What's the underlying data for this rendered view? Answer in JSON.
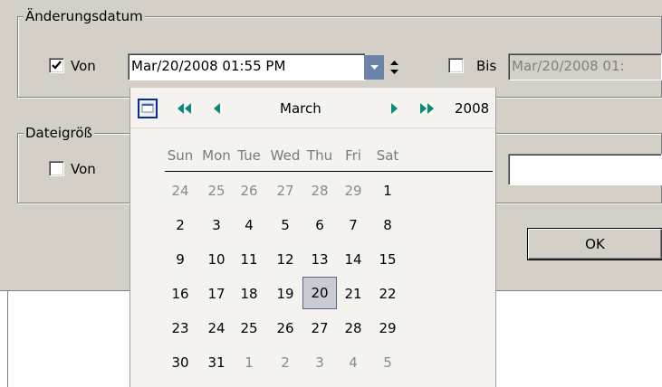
{
  "group_changed": {
    "legend": "Änderungsdatum",
    "from": {
      "label": "Von",
      "checked": true,
      "value": "Mar/20/2008 01:55 PM"
    },
    "to": {
      "label": "Bis",
      "checked": false,
      "value": "Mar/20/2008 01:"
    }
  },
  "group_size": {
    "legend": "Dateigröß",
    "from": {
      "label": "Von",
      "checked": false
    }
  },
  "ok_button": {
    "label": "OK"
  },
  "calendar": {
    "month": "March",
    "year": "2008",
    "weekdays": [
      "Sun",
      "Mon",
      "Tue",
      "Wed",
      "Thu",
      "Fri",
      "Sat"
    ],
    "weeks": [
      [
        {
          "d": "24",
          "o": true
        },
        {
          "d": "25",
          "o": true
        },
        {
          "d": "26",
          "o": true
        },
        {
          "d": "27",
          "o": true
        },
        {
          "d": "28",
          "o": true
        },
        {
          "d": "29",
          "o": true
        },
        {
          "d": "1",
          "o": false
        }
      ],
      [
        {
          "d": "2",
          "o": false
        },
        {
          "d": "3",
          "o": false
        },
        {
          "d": "4",
          "o": false
        },
        {
          "d": "5",
          "o": false
        },
        {
          "d": "6",
          "o": false
        },
        {
          "d": "7",
          "o": false
        },
        {
          "d": "8",
          "o": false
        }
      ],
      [
        {
          "d": "9",
          "o": false
        },
        {
          "d": "10",
          "o": false
        },
        {
          "d": "11",
          "o": false
        },
        {
          "d": "12",
          "o": false
        },
        {
          "d": "13",
          "o": false
        },
        {
          "d": "14",
          "o": false
        },
        {
          "d": "15",
          "o": false
        }
      ],
      [
        {
          "d": "16",
          "o": false
        },
        {
          "d": "17",
          "o": false
        },
        {
          "d": "18",
          "o": false
        },
        {
          "d": "19",
          "o": false
        },
        {
          "d": "20",
          "o": false,
          "selected": true
        },
        {
          "d": "21",
          "o": false
        },
        {
          "d": "22",
          "o": false
        }
      ],
      [
        {
          "d": "23",
          "o": false
        },
        {
          "d": "24",
          "o": false
        },
        {
          "d": "25",
          "o": false
        },
        {
          "d": "26",
          "o": false
        },
        {
          "d": "27",
          "o": false
        },
        {
          "d": "28",
          "o": false
        },
        {
          "d": "29",
          "o": false
        }
      ],
      [
        {
          "d": "30",
          "o": false
        },
        {
          "d": "31",
          "o": false
        },
        {
          "d": "1",
          "o": true
        },
        {
          "d": "2",
          "o": true
        },
        {
          "d": "3",
          "o": true
        },
        {
          "d": "4",
          "o": true
        },
        {
          "d": "5",
          "o": true
        }
      ]
    ],
    "icons": {
      "today": "calendar-today-icon",
      "prev_year": "double-left-arrow-icon",
      "prev_month": "left-arrow-icon",
      "next_month": "right-arrow-icon",
      "next_year": "double-right-arrow-icon"
    },
    "accent": "#0a8a78"
  }
}
